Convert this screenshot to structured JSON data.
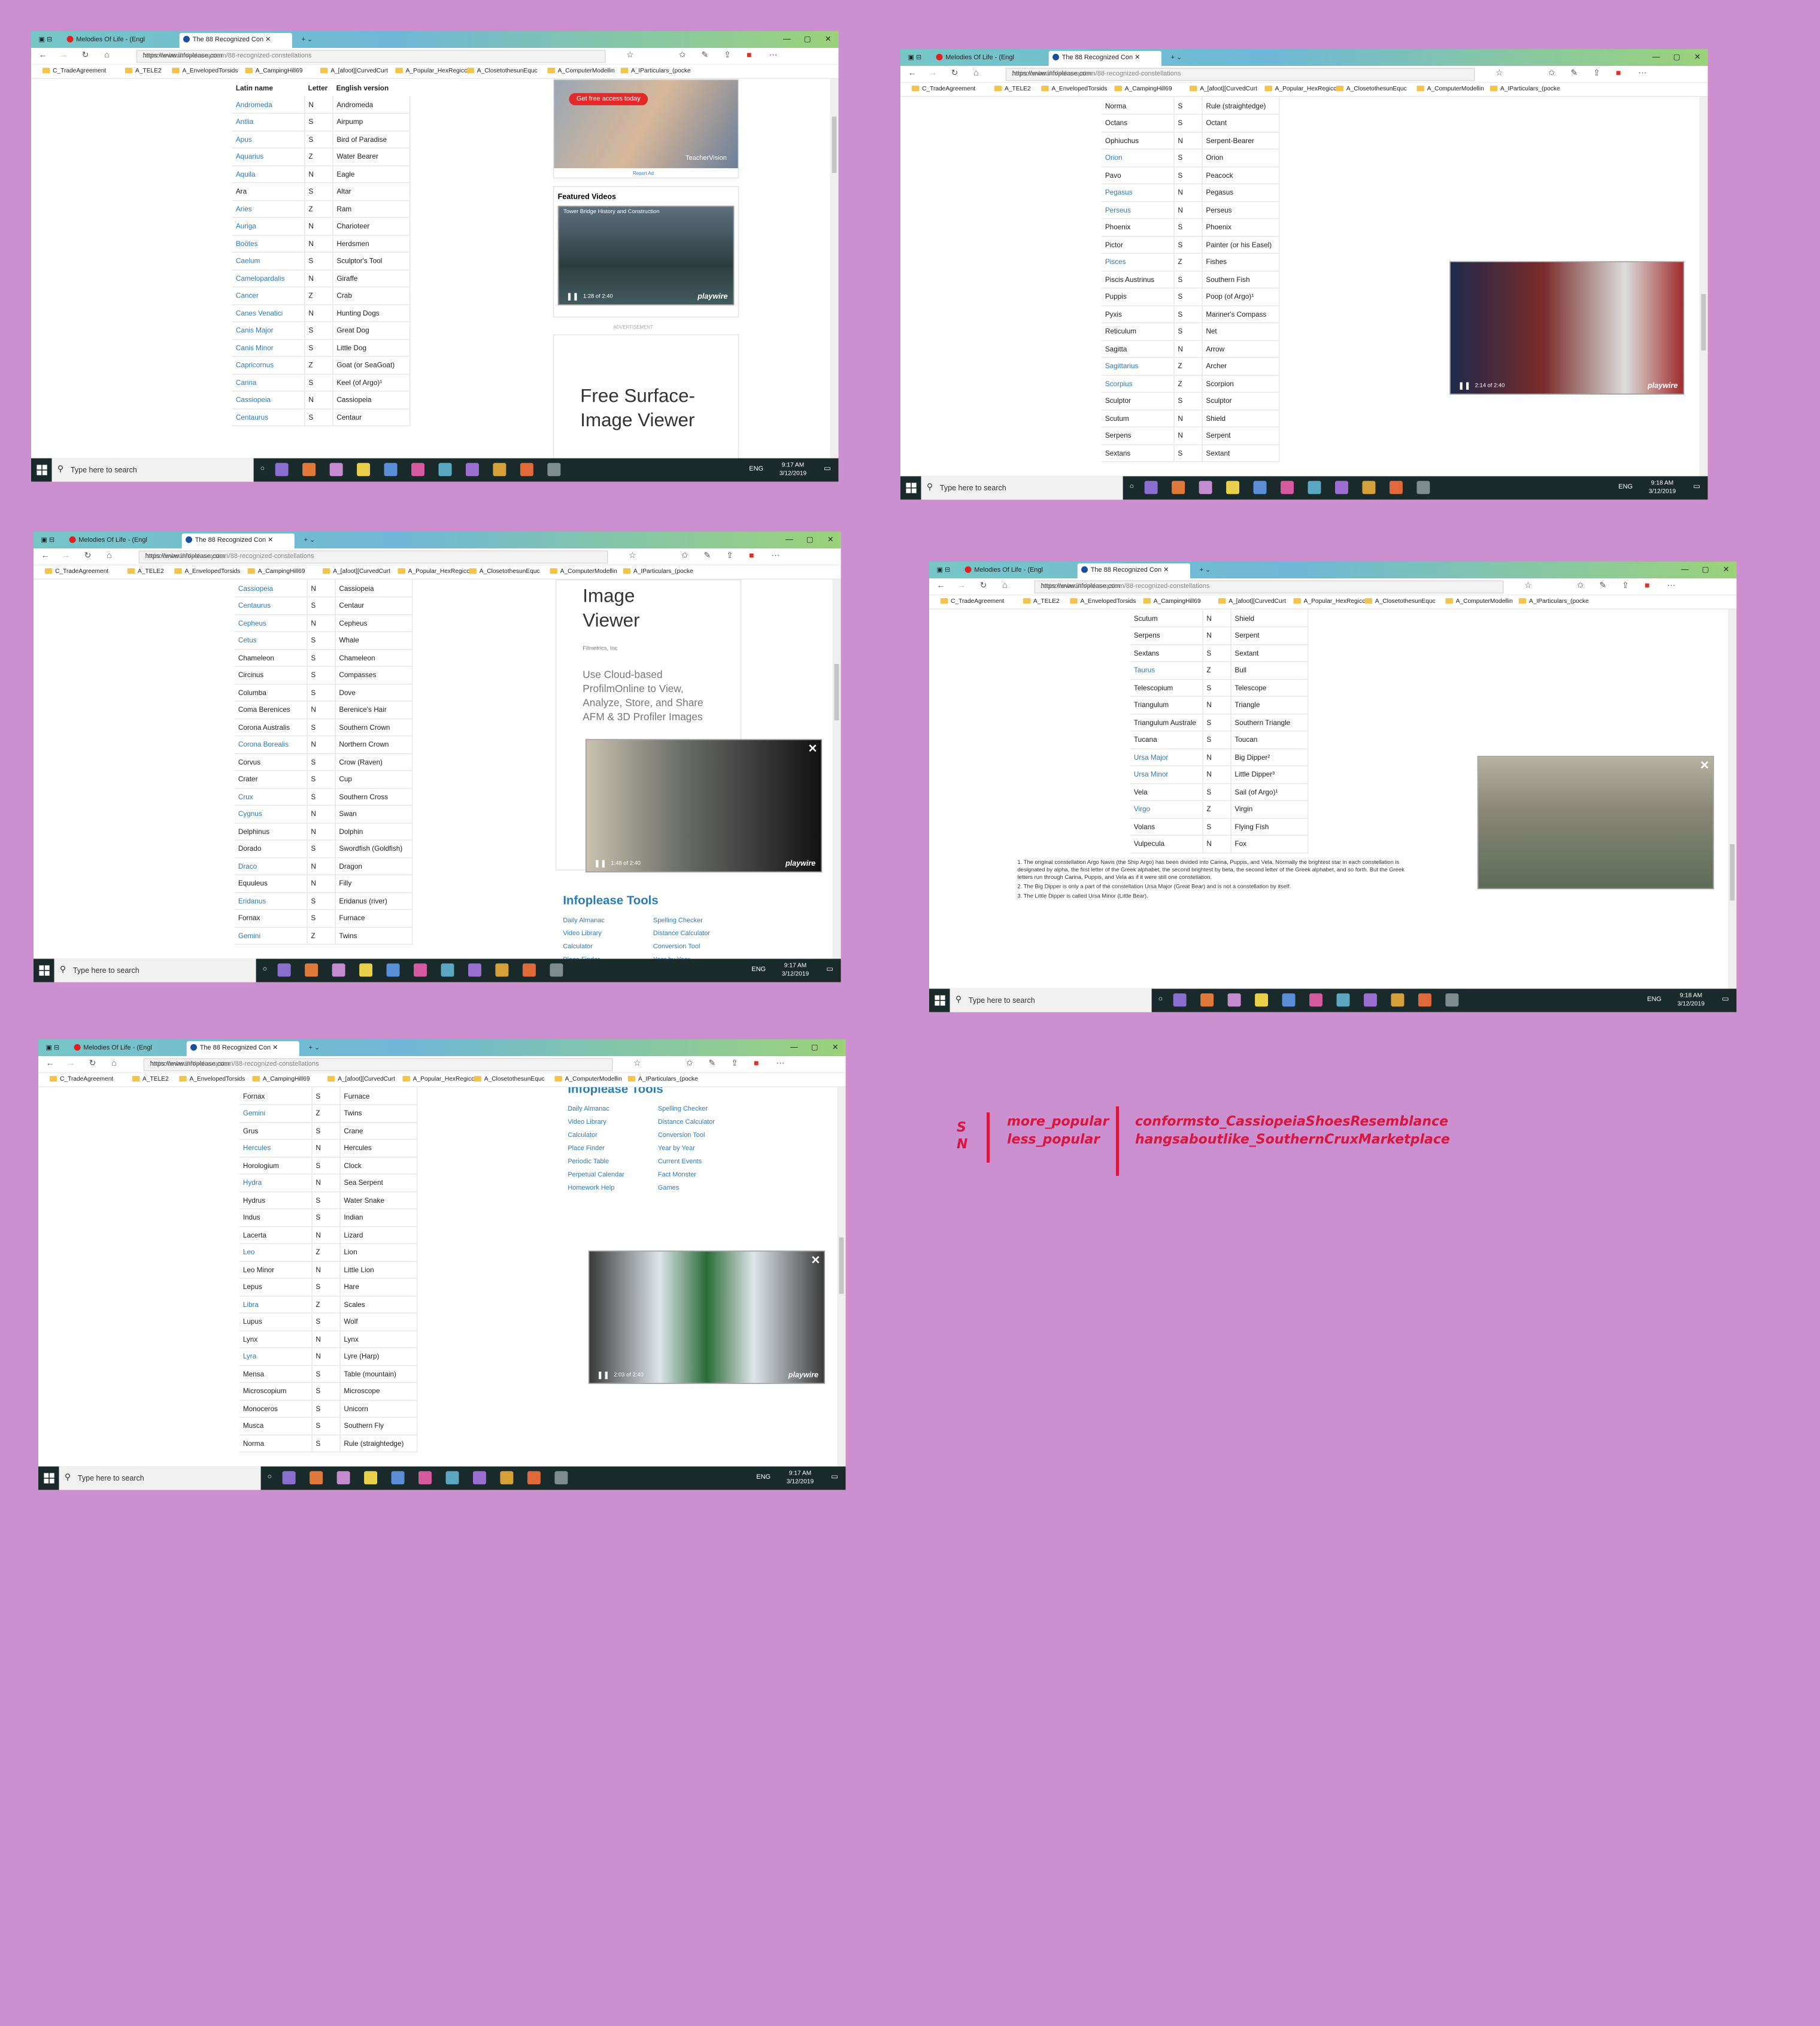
{
  "browser": {
    "tabs": [
      "Melodies Of Life - (Engl",
      "The 88 Recognized Con"
    ],
    "url_host": "https://www.infoplease.com",
    "url_path": "/science-health/solar-system/88-recognized-constellations",
    "bookmarks": [
      "C_TradeAgreement",
      "A_TELE2",
      "A_EnvelopedTorsids",
      "A_CampingHill69",
      "A_[afoot][CurvedCurt",
      "A_Popular_HexRegicc",
      "A_ClosetothesunEquc",
      "A_ComputerModellin",
      "A_IParticulars_(pocke"
    ]
  },
  "taskbar": {
    "search_placeholder": "Type here to search",
    "lang": "ENG",
    "date": "3/12/2019"
  },
  "times": [
    "9:17 AM",
    "9:18 AM",
    "9:17 AM",
    "9:18 AM",
    "9:17 AM"
  ],
  "table": {
    "headers": [
      "Latin name",
      "Letter",
      "English version"
    ],
    "rows": [
      [
        "Andromeda",
        "N",
        "Andromeda",
        1
      ],
      [
        "Antlia",
        "S",
        "Airpump",
        1
      ],
      [
        "Apus",
        "S",
        "Bird of Paradise",
        1
      ],
      [
        "Aquarius",
        "Z",
        "Water Bearer",
        1
      ],
      [
        "Aquila",
        "N",
        "Eagle",
        1
      ],
      [
        "Ara",
        "S",
        "Altar",
        0
      ],
      [
        "Aries",
        "Z",
        "Ram",
        1
      ],
      [
        "Auriga",
        "N",
        "Charioteer",
        1
      ],
      [
        "Boötes",
        "N",
        "Herdsmen",
        1
      ],
      [
        "Caelum",
        "S",
        "Sculptor's Tool",
        1
      ],
      [
        "Camelopardalis",
        "N",
        "Giraffe",
        1
      ],
      [
        "Cancer",
        "Z",
        "Crab",
        1
      ],
      [
        "Canes Venatici",
        "N",
        "Hunting Dogs",
        1
      ],
      [
        "Canis Major",
        "S",
        "Great Dog",
        1
      ],
      [
        "Canis Minor",
        "S",
        "Little Dog",
        1
      ],
      [
        "Capricornus",
        "Z",
        "Goat (or SeaGoat)",
        1
      ],
      [
        "Carina",
        "S",
        "Keel (of Argo)¹",
        1
      ],
      [
        "Cassiopeia",
        "N",
        "Cassiopeia",
        1
      ],
      [
        "Centaurus",
        "S",
        "Centaur",
        1
      ],
      [
        "Cepheus",
        "N",
        "Cepheus",
        1
      ],
      [
        "Cetus",
        "S",
        "Whale",
        1
      ],
      [
        "Chameleon",
        "S",
        "Chameleon",
        0
      ],
      [
        "Circinus",
        "S",
        "Compasses",
        0
      ],
      [
        "Columba",
        "S",
        "Dove",
        0
      ],
      [
        "Coma Berenices",
        "N",
        "Berenice's Hair",
        0
      ],
      [
        "Corona Australis",
        "S",
        "Southern Crown",
        0
      ],
      [
        "Corona Borealis",
        "N",
        "Northern Crown",
        1
      ],
      [
        "Corvus",
        "S",
        "Crow (Raven)",
        0
      ],
      [
        "Crater",
        "S",
        "Cup",
        0
      ],
      [
        "Crux",
        "S",
        "Southern Cross",
        1
      ],
      [
        "Cygnus",
        "N",
        "Swan",
        1
      ],
      [
        "Delphinus",
        "N",
        "Dolphin",
        0
      ],
      [
        "Dorado",
        "S",
        "Swordfish (Goldfish)",
        0
      ],
      [
        "Draco",
        "N",
        "Dragon",
        1
      ],
      [
        "Equuleus",
        "N",
        "Filly",
        0
      ],
      [
        "Eridanus",
        "S",
        "Eridanus (river)",
        1
      ],
      [
        "Fornax",
        "S",
        "Furnace",
        0
      ],
      [
        "Gemini",
        "Z",
        "Twins",
        1
      ],
      [
        "Grus",
        "S",
        "Crane",
        0
      ],
      [
        "Hercules",
        "N",
        "Hercules",
        1
      ],
      [
        "Horologium",
        "S",
        "Clock",
        0
      ],
      [
        "Hydra",
        "N",
        "Sea Serpent",
        1
      ],
      [
        "Hydrus",
        "S",
        "Water Snake",
        0
      ],
      [
        "Indus",
        "S",
        "Indian",
        0
      ],
      [
        "Lacerta",
        "N",
        "Lizard",
        0
      ],
      [
        "Leo",
        "Z",
        "Lion",
        1
      ],
      [
        "Leo Minor",
        "N",
        "Little Lion",
        0
      ],
      [
        "Lepus",
        "S",
        "Hare",
        0
      ],
      [
        "Libra",
        "Z",
        "Scales",
        1
      ],
      [
        "Lupus",
        "S",
        "Wolf",
        0
      ],
      [
        "Lynx",
        "N",
        "Lynx",
        0
      ],
      [
        "Lyra",
        "N",
        "Lyre (Harp)",
        1
      ],
      [
        "Mensa",
        "S",
        "Table (mountain)",
        0
      ],
      [
        "Microscopium",
        "S",
        "Microscope",
        0
      ],
      [
        "Monoceros",
        "S",
        "Unicorn",
        0
      ],
      [
        "Musca",
        "S",
        "Southern Fly",
        0
      ],
      [
        "Norma",
        "S",
        "Rule (straightedge)",
        0
      ],
      [
        "Octans",
        "S",
        "Octant",
        0
      ],
      [
        "Ophiuchus",
        "N",
        "Serpent-Bearer",
        0
      ],
      [
        "Orion",
        "S",
        "Orion",
        1
      ],
      [
        "Pavo",
        "S",
        "Peacock",
        0
      ],
      [
        "Pegasus",
        "N",
        "Pegasus",
        1
      ],
      [
        "Perseus",
        "N",
        "Perseus",
        1
      ],
      [
        "Phoenix",
        "S",
        "Phoenix",
        0
      ],
      [
        "Pictor",
        "S",
        "Painter (or his Easel)",
        0
      ],
      [
        "Pisces",
        "Z",
        "Fishes",
        1
      ],
      [
        "Piscis Austrinus",
        "S",
        "Southern Fish",
        0
      ],
      [
        "Puppis",
        "S",
        "Poop (of Argo)¹",
        0
      ],
      [
        "Pyxis",
        "S",
        "Mariner's Compass",
        0
      ],
      [
        "Reticulum",
        "S",
        "Net",
        0
      ],
      [
        "Sagitta",
        "N",
        "Arrow",
        0
      ],
      [
        "Sagittarius",
        "Z",
        "Archer",
        1
      ],
      [
        "Scorpius",
        "Z",
        "Scorpion",
        1
      ],
      [
        "Sculptor",
        "S",
        "Sculptor",
        0
      ],
      [
        "Scutum",
        "N",
        "Shield",
        0
      ],
      [
        "Serpens",
        "N",
        "Serpent",
        0
      ],
      [
        "Sextans",
        "S",
        "Sextant",
        0
      ],
      [
        "Taurus",
        "Z",
        "Bull",
        1
      ],
      [
        "Telescopium",
        "S",
        "Telescope",
        0
      ],
      [
        "Triangulum",
        "N",
        "Triangle",
        0
      ],
      [
        "Triangulum Australe",
        "S",
        "Southern Triangle",
        0
      ],
      [
        "Tucana",
        "S",
        "Toucan",
        0
      ],
      [
        "Ursa Major",
        "N",
        "Big Dipper²",
        1
      ],
      [
        "Ursa Minor",
        "N",
        "Little Dipper³",
        1
      ],
      [
        "Vela",
        "S",
        "Sail (of Argo)¹",
        0
      ],
      [
        "Virgo",
        "Z",
        "Virgin",
        1
      ],
      [
        "Volans",
        "S",
        "Flying Fish",
        0
      ],
      [
        "Vulpecula",
        "N",
        "Fox",
        0
      ]
    ]
  },
  "ads": {
    "cta": "Get free access today",
    "brand": "TeacherVision",
    "report": "Report Ad",
    "featured": "Featured Videos",
    "video1_title": "Tower Bridge History and Construction",
    "advert": "ADVERTISEMENT",
    "fs_title": "Free Surface-Image Viewer",
    "fs_company": "Filmetrics, Inc",
    "fs_body": "Use Cloud-based ProfilmOnline to View, Analyze, Store, and Share AFM & 3D Profiler Images",
    "tools_title": "Infoplease Tools",
    "tools_left": [
      "Daily Almanac",
      "Video Library",
      "Calculator",
      "Place Finder",
      "Periodic Table",
      "Perpetual Calendar",
      "Homework Help"
    ],
    "tools_right": [
      "Spelling Checker",
      "Distance Calculator",
      "Conversion Tool",
      "Year by Year",
      "Current Events",
      "Fact Monster",
      "Games"
    ]
  },
  "video": {
    "brand": "playwire",
    "t1": "1:28 of 2:40",
    "t2": "2:14 of 2:40",
    "t3": "1:48 of 2:40",
    "t5": "2:03 of 2:40"
  },
  "footnotes": [
    "1. The original constellation Argo Navis (the Ship Argo) has been divided into Carina, Puppis, and Vela. Normally the brightest star in each constellation is designated by alpha, the first letter of the Greek alphabet, the second brightest by beta, the second letter of the Greek alphabet, and so forth. But the Greek letters run through Carina, Puppis, and Vela as if it were still one constellation.",
    "2. The Big Dipper is only a part of the constellation Ursa Major (Great Bear) and is not a constellation by itself.",
    "3. The Little Dipper is called Ursa Minor (Little Bear)."
  ],
  "legend": {
    "k1": "S",
    "k2": "N",
    "v1": "more_popular",
    "v2": "less_popular",
    "w1": "conformsto_CassiopeiaShoesResemblance",
    "w2": "hangsaboutlike_SouthernCruxMarketplace"
  },
  "colors": {
    "background": "#cc8fcf",
    "link": "#2b7bb9",
    "legend": "#d8163e",
    "taskbar": "#1a2a2a"
  }
}
